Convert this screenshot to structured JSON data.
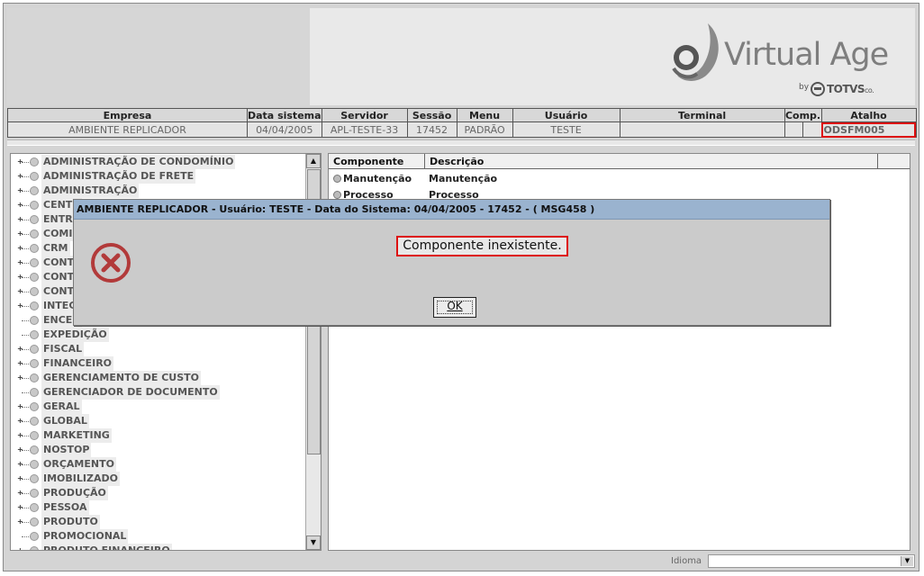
{
  "brand": {
    "name": "Virtual Age",
    "by": "by",
    "totvs": "TOTVS",
    "co": "co."
  },
  "info_headers": [
    "Empresa",
    "Data sistema",
    "Servidor",
    "Sessão",
    "Menu",
    "Usuário",
    "Terminal",
    "Comp.",
    "Atalho"
  ],
  "info_values": [
    "AMBIENTE REPLICADOR",
    "04/04/2005",
    "APL-TESTE-33",
    "17452",
    "PADRÃO",
    "TESTE",
    "",
    "",
    "ODSFM005"
  ],
  "tree": {
    "items": [
      {
        "label": "ADMINISTRAÇÃO DE CONDOMÍNIO",
        "expandable": true
      },
      {
        "label": "ADMINISTRAÇÃO DE FRETE",
        "expandable": true
      },
      {
        "label": "ADMINISTRAÇÃO",
        "expandable": true
      },
      {
        "label": "CENTR",
        "expandable": true
      },
      {
        "label": "ENTRA",
        "expandable": true
      },
      {
        "label": "COMIS",
        "expandable": true
      },
      {
        "label": "CRM",
        "expandable": true
      },
      {
        "label": "CONTA",
        "expandable": true
      },
      {
        "label": "CONTA",
        "expandable": true
      },
      {
        "label": "CONTI",
        "expandable": true
      },
      {
        "label": "INTEG",
        "expandable": true
      },
      {
        "label": "ENCER",
        "expandable": false
      },
      {
        "label": "EXPEDIÇÃO",
        "expandable": false
      },
      {
        "label": "FISCAL",
        "expandable": true
      },
      {
        "label": "FINANCEIRO",
        "expandable": true
      },
      {
        "label": "GERENCIAMENTO DE CUSTO",
        "expandable": true
      },
      {
        "label": "GERENCIADOR DE DOCUMENTO",
        "expandable": false
      },
      {
        "label": "GERAL",
        "expandable": true
      },
      {
        "label": "GLOBAL",
        "expandable": true
      },
      {
        "label": "MARKETING",
        "expandable": true
      },
      {
        "label": "NOSTOP",
        "expandable": true
      },
      {
        "label": "ORÇAMENTO",
        "expandable": true
      },
      {
        "label": "IMOBILIZADO",
        "expandable": true
      },
      {
        "label": "PRODUÇÃO",
        "expandable": true
      },
      {
        "label": "PESSOA",
        "expandable": true
      },
      {
        "label": "PRODUTO",
        "expandable": true
      },
      {
        "label": "PROMOCIONAL",
        "expandable": false
      },
      {
        "label": "PRODUTO FINANCEIRO",
        "expandable": true
      }
    ]
  },
  "grid": {
    "columns": [
      "Componente",
      "Descrição"
    ],
    "rows": [
      {
        "componente": "Manutenção",
        "descricao": "Manutenção"
      },
      {
        "componente": "Processo",
        "descricao": "Processo"
      }
    ]
  },
  "status": {
    "idioma_label": "Idioma",
    "idioma_value": ""
  },
  "dialog": {
    "title": "AMBIENTE REPLICADOR - Usuário: TESTE - Data do Sistema: 04/04/2005 - 17452 - ( MSG458 )",
    "message": "Componente inexistente.",
    "ok_label": "OK",
    "icon": "error-x-icon"
  },
  "colors": {
    "dialog_title_bg": "#9ab3cf",
    "error_icon": "#b23a3a",
    "highlight": "#dd1111"
  }
}
